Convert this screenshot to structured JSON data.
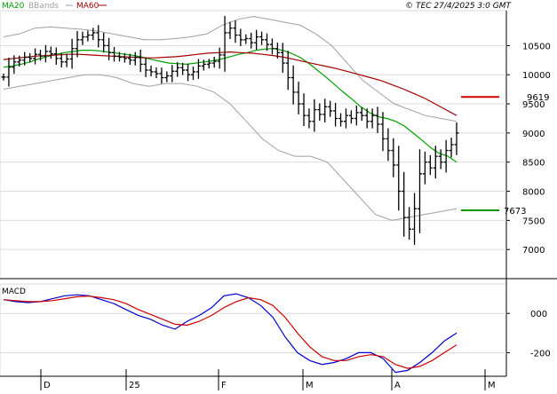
{
  "header": {
    "legend": [
      {
        "label": "MA20",
        "color": "#00a000"
      },
      {
        "label": "BBands",
        "color": "#a0a0a0"
      },
      {
        "label": "MA60",
        "color": "#a00000"
      }
    ],
    "source": "© TEC 27/4/2025 3:0 GMT"
  },
  "levels": {
    "resistance": {
      "value": 9619,
      "label": "9619",
      "color": "#cc0000"
    },
    "support": {
      "value": 7673,
      "label": "7673",
      "color": "#009900"
    }
  },
  "macd_label": "MACD",
  "x_labels": [
    "D",
    "25",
    "F",
    "M",
    "A",
    "M"
  ],
  "chart_data": [
    {
      "type": "ohlc",
      "title": "",
      "y_ticks": [
        10500,
        10000,
        9500,
        9000,
        8500,
        8000,
        7500,
        7000
      ],
      "y_tick_labels": [
        "10500",
        "10000",
        "9500",
        "9000",
        "8500",
        "8000",
        "7500",
        "7000"
      ],
      "ylim": [
        6500,
        11100
      ],
      "grid": true,
      "closes": [
        9960,
        10130,
        10220,
        10250,
        10300,
        10280,
        10350,
        10320,
        10400,
        10360,
        10280,
        10220,
        10270,
        10450,
        10600,
        10650,
        10680,
        10720,
        10600,
        10500,
        10380,
        10320,
        10300,
        10280,
        10250,
        10300,
        10180,
        10080,
        10050,
        10020,
        9950,
        9980,
        10060,
        10120,
        10080,
        10000,
        10050,
        10150,
        10180,
        10200,
        10230,
        10340,
        10720,
        10800,
        10680,
        10600,
        10620,
        10550,
        10650,
        10600,
        10520,
        10450,
        10380,
        10200,
        9950,
        9700,
        9500,
        9300,
        9200,
        9400,
        9320,
        9450,
        9380,
        9250,
        9200,
        9300,
        9250,
        9350,
        9300,
        9200,
        9300,
        9150,
        8900,
        8700,
        8450,
        8000,
        7550,
        7350,
        7700,
        8300,
        8500,
        8400,
        8600,
        8500,
        8700,
        8800,
        9000
      ],
      "series": [
        {
          "name": "MA20",
          "color": "#00a000",
          "values": [
            10130,
            10150,
            10180,
            10220,
            10270,
            10310,
            10350,
            10380,
            10400,
            10420,
            10420,
            10410,
            10390,
            10370,
            10350,
            10330,
            10300,
            10260,
            10230,
            10200,
            10190,
            10180,
            10200,
            10220,
            10240,
            10270,
            10310,
            10350,
            10380,
            10420,
            10440,
            10450,
            10420,
            10370,
            10300,
            10200,
            10080,
            9960,
            9830,
            9700,
            9580,
            9450,
            9350,
            9280,
            9250,
            9200,
            9120,
            9000,
            8880,
            8750,
            8650,
            8600,
            8500
          ]
        },
        {
          "name": "MA60",
          "color": "#a00000",
          "values": [
            10260,
            10280,
            10300,
            10320,
            10330,
            10340,
            10350,
            10350,
            10340,
            10330,
            10320,
            10310,
            10300,
            10290,
            10290,
            10300,
            10310,
            10330,
            10350,
            10370,
            10380,
            10390,
            10380,
            10370,
            10350,
            10330,
            10300,
            10260,
            10220,
            10180,
            10140,
            10100,
            10050,
            10000,
            9950,
            9900,
            9830,
            9760,
            9680,
            9600,
            9500,
            9400,
            9300
          ]
        },
        {
          "name": "BB upper",
          "color": "#a0a0a0",
          "values": [
            10650,
            10700,
            10800,
            10820,
            10800,
            10780,
            10750,
            10700,
            10650,
            10600,
            10600,
            10620,
            10650,
            10700,
            10850,
            10950,
            11000,
            10950,
            10900,
            10850,
            10700,
            10500,
            10200,
            9900,
            9700,
            9500,
            9400,
            9300,
            9250,
            9200
          ]
        },
        {
          "name": "BB lower",
          "color": "#a0a0a0",
          "values": [
            9750,
            9800,
            9850,
            9900,
            9950,
            10000,
            10000,
            9950,
            9850,
            9800,
            9850,
            9850,
            9800,
            9700,
            9500,
            9200,
            8900,
            8700,
            8600,
            8600,
            8500,
            8200,
            7900,
            7600,
            7500,
            7550,
            7600,
            7650,
            7700
          ]
        }
      ]
    },
    {
      "type": "line",
      "title": "MACD",
      "y_ticks": [
        0,
        -200
      ],
      "y_tick_labels": "000|-200",
      "ylim": [
        -320,
        150
      ],
      "grid": true,
      "series": [
        {
          "name": "MACD",
          "color": "#0000cc",
          "values": [
            70,
            60,
            55,
            60,
            75,
            90,
            95,
            90,
            70,
            50,
            20,
            -10,
            -30,
            -60,
            -80,
            -40,
            -10,
            30,
            90,
            100,
            80,
            40,
            -20,
            -120,
            -200,
            -240,
            -260,
            -250,
            -230,
            -200,
            -200,
            -230,
            -300,
            -290,
            -250,
            -200,
            -140,
            -100
          ]
        },
        {
          "name": "Signal",
          "color": "#cc0000",
          "values": [
            70,
            65,
            60,
            60,
            65,
            75,
            85,
            88,
            80,
            70,
            50,
            20,
            -5,
            -30,
            -55,
            -60,
            -40,
            -10,
            30,
            60,
            80,
            70,
            40,
            -20,
            -100,
            -170,
            -220,
            -240,
            -240,
            -220,
            -210,
            -220,
            -260,
            -280,
            -270,
            -240,
            -200,
            -160
          ]
        }
      ]
    }
  ]
}
